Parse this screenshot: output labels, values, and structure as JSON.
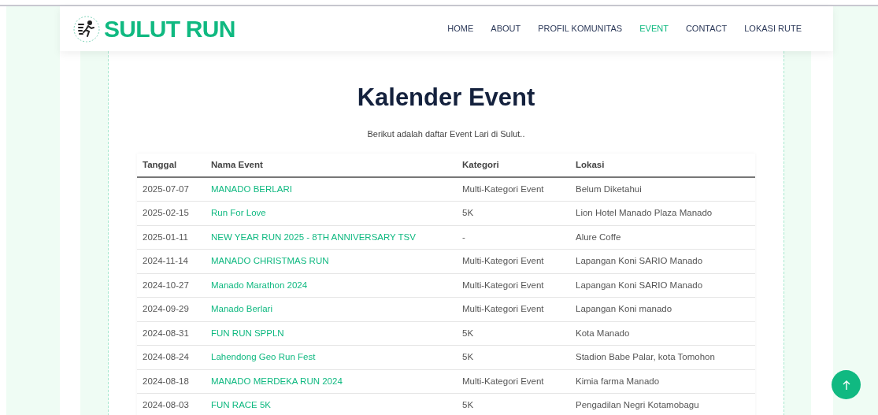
{
  "brand": {
    "name": "SULUT RUN"
  },
  "nav": [
    {
      "label": "HOME",
      "selected": false
    },
    {
      "label": "ABOUT",
      "selected": false
    },
    {
      "label": "PROFIL KOMUNITAS",
      "selected": false
    },
    {
      "label": "EVENT",
      "selected": true
    },
    {
      "label": "CONTACT",
      "selected": false
    },
    {
      "label": "LOKASI RUTE",
      "selected": false
    }
  ],
  "heading": "Kalender Event",
  "subtitle": "Berikut adalah daftar Event Lari di Sulut..",
  "table": {
    "columns": [
      "Tanggal",
      "Nama Event",
      "Kategori",
      "Lokasi"
    ],
    "rows": [
      [
        "2025-07-07",
        "MANADO BERLARI",
        "Multi-Kategori Event",
        "Belum Diketahui"
      ],
      [
        "2025-02-15",
        "Run For Love",
        "5K",
        "Lion Hotel Manado Plaza Manado"
      ],
      [
        "2025-01-11",
        "NEW YEAR RUN 2025 - 8TH ANNIVERSARY TSV",
        "-",
        "Alure Coffe"
      ],
      [
        "2024-11-14",
        "MANADO CHRISTMAS RUN",
        "Multi-Kategori Event",
        "Lapangan Koni SARIO Manado"
      ],
      [
        "2024-10-27",
        "Manado Marathon 2024",
        "Multi-Kategori Event",
        "Lapangan Koni SARIO Manado"
      ],
      [
        "2024-09-29",
        "Manado Berlari",
        "Multi-Kategori Event",
        "Lapangan Koni manado"
      ],
      [
        "2024-08-31",
        "FUN RUN SPPLN",
        "5K",
        "Kota Manado"
      ],
      [
        "2024-08-24",
        "Lahendong Geo Run Fest",
        "5K",
        "Stadion Babe Palar, kota Tomohon"
      ],
      [
        "2024-08-18",
        "MANADO MERDEKA RUN 2024",
        "Multi-Kategori Event",
        "Kimia farma Manado"
      ],
      [
        "2024-08-03",
        "FUN RACE 5K",
        "5K",
        "Pengadilan Negri Kotamobagu"
      ]
    ]
  }
}
